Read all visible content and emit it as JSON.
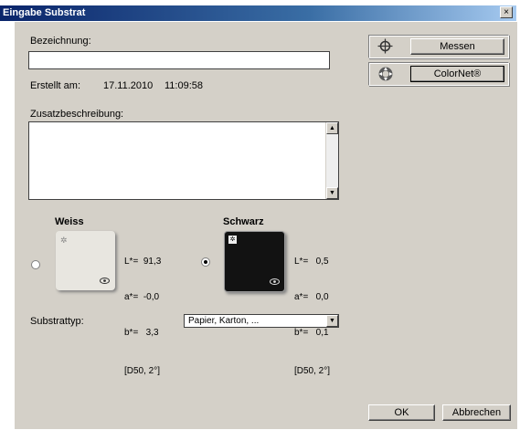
{
  "window": {
    "title": "Eingabe Substrat",
    "close_glyph": "×"
  },
  "form": {
    "bezeichnung_label": "Bezeichnung:",
    "bezeichnung_value": "",
    "erstellt_label": "Erstellt am:",
    "erstellt_date": "17.11.2010",
    "erstellt_time": "11:09:58",
    "zusatz_label": "Zusatzbeschreibung:",
    "zusatz_value": ""
  },
  "actions": {
    "messen_label": "Messen",
    "colornet_label": "ColorNet®",
    "ok_label": "OK",
    "cancel_label": "Abbrechen"
  },
  "icons": {
    "messen": "crosshair-icon",
    "colornet": "colornet-icon"
  },
  "weiss": {
    "title": "Weiss",
    "color": "#e8e6e0",
    "selected": false,
    "l": "L*=  91,3",
    "a": "a*=  -0,0",
    "b": "b*=   3,3",
    "illuminant": "[D50, 2°]"
  },
  "schwarz": {
    "title": "Schwarz",
    "color": "#121212",
    "selected": true,
    "l": "L*=   0,5",
    "a": "a*=   0,0",
    "b": "b*=   0,1",
    "illuminant": "[D50, 2°]"
  },
  "substrat": {
    "label": "Substrattyp:",
    "selected": "Papier, Karton, ..."
  }
}
